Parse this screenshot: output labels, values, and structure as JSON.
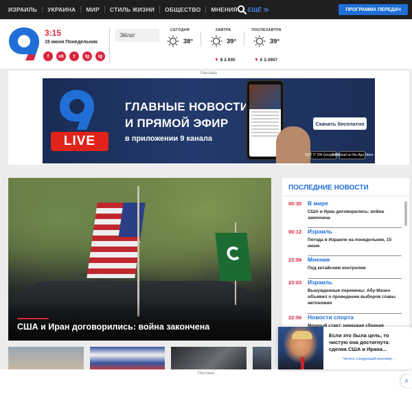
{
  "nav": {
    "items": [
      "ИЗРАИЛЬ",
      "УКРАИНА",
      "МИР",
      "СТИЛЬ ЖИЗНИ",
      "ОБЩЕСТВО",
      "МНЕНИЯ"
    ],
    "more": "ЕЩЁ ≫",
    "program_button": "ПРОГРАММА ПЕРЕДАЧ"
  },
  "header": {
    "logo_text": "9",
    "time": "3:15",
    "date": "15 июня Понедельник",
    "socials": [
      "f",
      "vk",
      "t",
      "tg",
      "ig"
    ],
    "city": "Эйлат",
    "weather": [
      {
        "label": "СЕГОДНЯ",
        "temp": "38°"
      },
      {
        "label": "ЗАВТРА",
        "temp": "39°"
      },
      {
        "label": "ПОСЛЕЗАВТРА",
        "temp": "39°"
      }
    ],
    "rates": [
      {
        "arrow": "▼",
        "value": "$ 2.935"
      },
      {
        "arrow": "▼",
        "value": "€ 3.3957"
      }
    ]
  },
  "ad": {
    "label": "Реклама",
    "live": "LIVE",
    "line1": "ГЛАВНЫЕ НОВОСТИ",
    "line2": "И ПРЯМОЙ ЭФИР",
    "line3": "в приложении 9 канала",
    "cta": "Скачать бесплатно",
    "store1": "GET IT ON Google Play",
    "store2": "Download on the App Store"
  },
  "hero": {
    "title": "США и Иран договорились: война закончена"
  },
  "news": {
    "heading": "ПОСЛЕДНИЕ НОВОСТИ",
    "items": [
      {
        "time": "00:30",
        "category": "В мире",
        "text": "США и Иран договорились: война закончена"
      },
      {
        "time": "00:12",
        "category": "Израиль",
        "text": "Погода в Израиле на понедельник, 15 июня"
      },
      {
        "time": "23:59",
        "category": "Мнения",
        "text": "Под китайским контролем"
      },
      {
        "time": "23:03",
        "category": "Израиль",
        "text": "Вынужденные перемены: Абу-Мазен объявил о проведении выборов главы автономии"
      },
      {
        "time": "22:56",
        "category": "Новости спорта",
        "text": "Мощный старт: немецкая сборная"
      }
    ]
  },
  "bottom": {
    "label": "Реклама"
  },
  "popup": {
    "text": "Если это была цель, то чистую она достигнута: сделка США и Ирана...",
    "link": "Читать следующий рекламу ›",
    "close": "X"
  },
  "colors": {
    "accent_red": "#d7263d",
    "brand_blue": "#1f6fd6",
    "nav_bg": "#1f1f1f"
  }
}
